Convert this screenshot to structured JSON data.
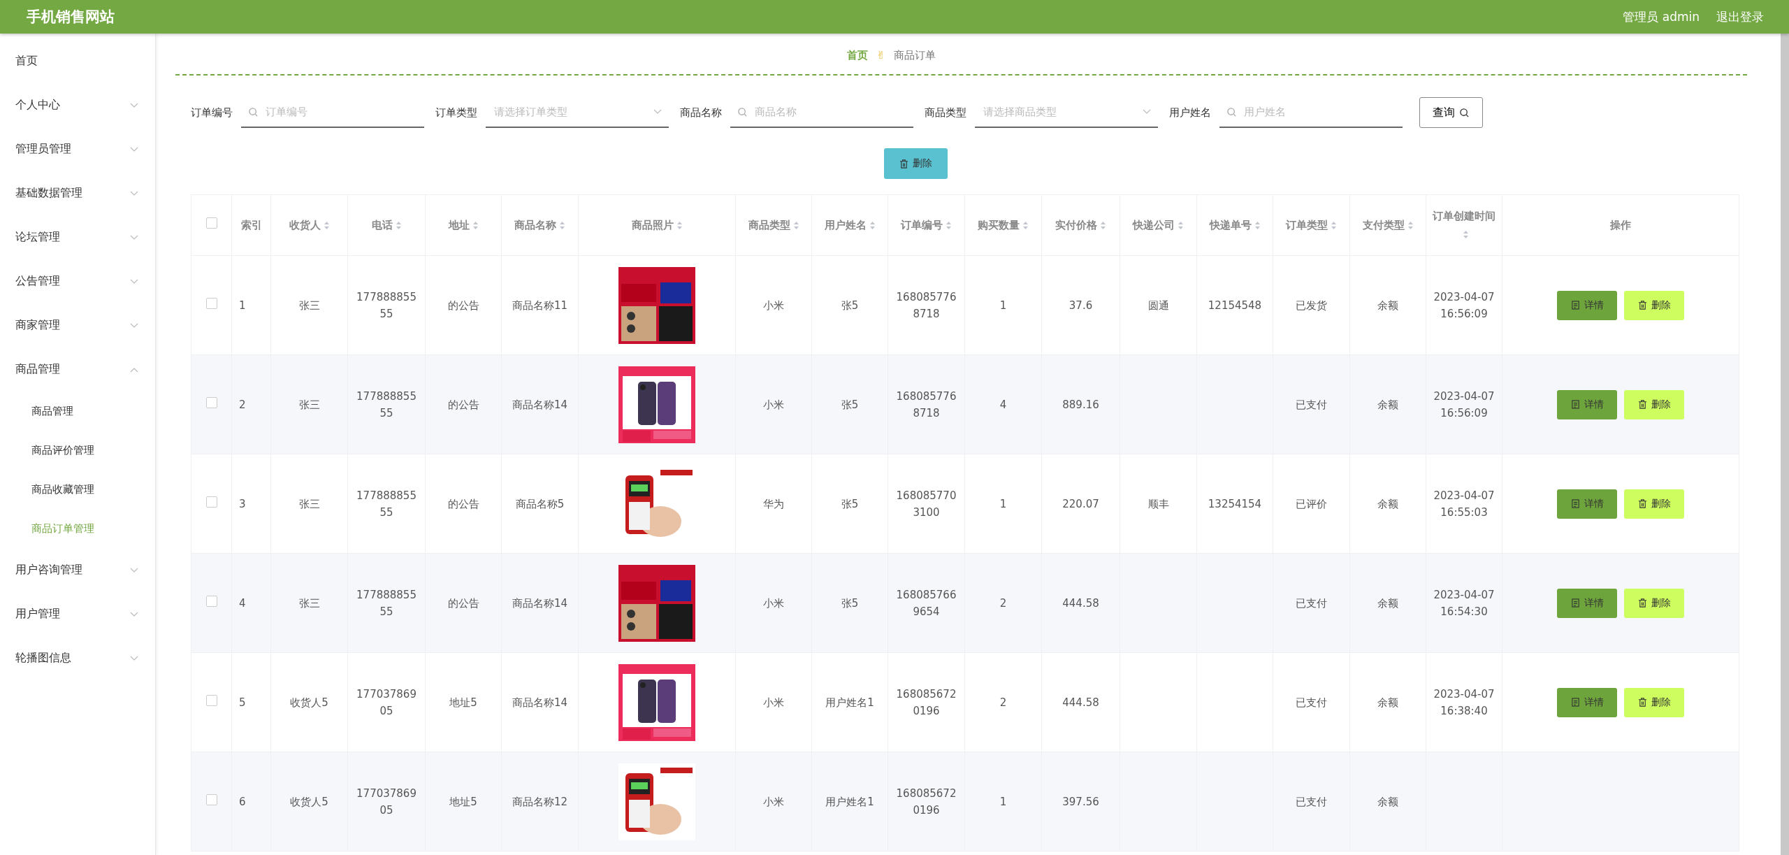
{
  "header": {
    "title": "手机销售网站",
    "user": "管理员 admin",
    "logout": "退出登录"
  },
  "sidebar": {
    "items": [
      {
        "label": "首页",
        "has_children": false,
        "selected": false
      },
      {
        "label": "个人中心",
        "has_children": true,
        "expanded": false,
        "selected": false
      },
      {
        "label": "管理员管理",
        "has_children": true,
        "expanded": false,
        "selected": false
      },
      {
        "label": "基础数据管理",
        "has_children": true,
        "expanded": false,
        "selected": false
      },
      {
        "label": "论坛管理",
        "has_children": true,
        "expanded": false,
        "selected": false
      },
      {
        "label": "公告管理",
        "has_children": true,
        "expanded": false,
        "selected": false
      },
      {
        "label": "商家管理",
        "has_children": true,
        "expanded": false,
        "selected": false
      },
      {
        "label": "商品管理",
        "has_children": true,
        "expanded": true,
        "selected": false,
        "children": [
          {
            "label": "商品管理",
            "selected": false
          },
          {
            "label": "商品评价管理",
            "selected": false
          },
          {
            "label": "商品收藏管理",
            "selected": false
          },
          {
            "label": "商品订单管理",
            "selected": true
          }
        ]
      },
      {
        "label": "用户咨询管理",
        "has_children": true,
        "expanded": false,
        "selected": false
      },
      {
        "label": "用户管理",
        "has_children": true,
        "expanded": false,
        "selected": false
      },
      {
        "label": "轮播图信息",
        "has_children": true,
        "expanded": false,
        "selected": false
      }
    ]
  },
  "breadcrumb": {
    "home": "首页",
    "separator": "✌",
    "current": "商品订单"
  },
  "filters": [
    {
      "label": "订单编号",
      "kind": "search",
      "placeholder": "订单编号"
    },
    {
      "label": "订单类型",
      "kind": "select",
      "placeholder": "请选择订单类型"
    },
    {
      "label": "商品名称",
      "kind": "search",
      "placeholder": "商品名称"
    },
    {
      "label": "商品类型",
      "kind": "select",
      "placeholder": "请选择商品类型"
    },
    {
      "label": "用户姓名",
      "kind": "search",
      "placeholder": "用户姓名"
    }
  ],
  "query_button": "查询",
  "delete_button": "删除",
  "table": {
    "select_all": {
      "checked": false
    },
    "columns": [
      {
        "label": "索引",
        "sortable": false
      },
      {
        "label": "收货人",
        "sortable": true
      },
      {
        "label": "电话",
        "sortable": true
      },
      {
        "label": "地址",
        "sortable": true
      },
      {
        "label": "商品名称",
        "sortable": true
      },
      {
        "label": "商品照片",
        "sortable": true
      },
      {
        "label": "商品类型",
        "sortable": true
      },
      {
        "label": "用户姓名",
        "sortable": true
      },
      {
        "label": "订单编号",
        "sortable": true
      },
      {
        "label": "购买数量",
        "sortable": true
      },
      {
        "label": "实付价格",
        "sortable": true
      },
      {
        "label": "快递公司",
        "sortable": true
      },
      {
        "label": "快递单号",
        "sortable": true
      },
      {
        "label": "订单类型",
        "sortable": true
      },
      {
        "label": "支付类型",
        "sortable": true
      },
      {
        "label": "订单创建时间",
        "sortable": true
      },
      {
        "label": "操作",
        "sortable": false
      }
    ],
    "rows": [
      {
        "checked": false,
        "cells": [
          "1",
          "张三",
          "17788885555",
          "的公告",
          "商品名称11",
          {
            "kind": "picture"
          },
          "小米",
          "张5",
          "1680857768718",
          "1",
          "37.6",
          "圆通",
          "12154548",
          "已发货",
          "余额",
          "2023-04-07 16:56:09"
        ],
        "actions": [
          "详情",
          "删除"
        ]
      },
      {
        "checked": false,
        "cells": [
          "2",
          "张三",
          "17788885555",
          "的公告",
          "商品名称14",
          {
            "kind": "picture"
          },
          "小米",
          "张5",
          "1680857768718",
          "4",
          "889.16",
          "",
          "",
          "已支付",
          "余额",
          "2023-04-07 16:56:09"
        ],
        "actions": [
          "详情",
          "删除"
        ]
      },
      {
        "checked": false,
        "cells": [
          "3",
          "张三",
          "17788885555",
          "的公告",
          "商品名称5",
          {
            "kind": "picture"
          },
          "华为",
          "张5",
          "1680857703100",
          "1",
          "220.07",
          "顺丰",
          "13254154",
          "已评价",
          "余额",
          "2023-04-07 16:55:03"
        ],
        "actions": [
          "详情",
          "删除"
        ]
      },
      {
        "checked": false,
        "cells": [
          "4",
          "张三",
          "17788885555",
          "的公告",
          "商品名称14",
          {
            "kind": "picture"
          },
          "小米",
          "张5",
          "1680857669654",
          "2",
          "444.58",
          "",
          "",
          "已支付",
          "余额",
          "2023-04-07 16:54:30"
        ],
        "actions": [
          "详情",
          "删除"
        ]
      },
      {
        "checked": false,
        "cells": [
          "5",
          "收货人5",
          "17703786905",
          "地址5",
          "商品名称14",
          {
            "kind": "picture"
          },
          "小米",
          "用户姓名1",
          "1680856720196",
          "2",
          "444.58",
          "",
          "",
          "已支付",
          "余额",
          "2023-04-07 16:38:40"
        ],
        "actions": [
          "详情",
          "删除"
        ]
      },
      {
        "checked": false,
        "cells": [
          "6",
          "收货人5",
          "17703786905",
          "地址5",
          "商品名称12",
          {
            "kind": "picture"
          },
          "小米",
          "用户姓名1",
          "1680856720196",
          "1",
          "397.56",
          "",
          "",
          "已支付",
          "余额",
          ""
        ]
      }
    ]
  }
}
